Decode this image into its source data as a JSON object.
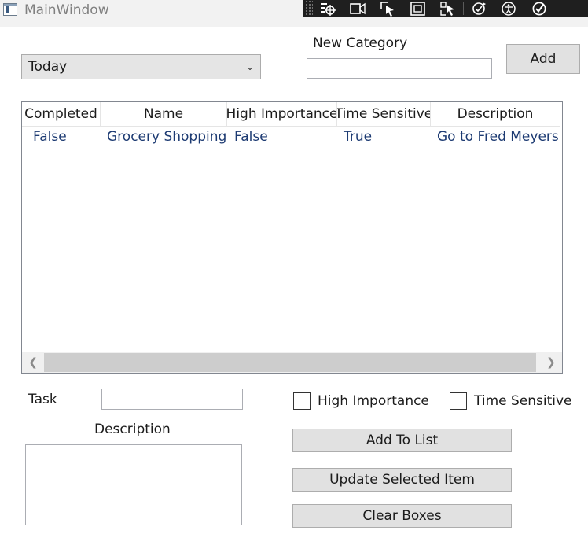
{
  "window": {
    "title": "MainWindow"
  },
  "debug_toolbar": {
    "buttons": [
      "select-element-icon",
      "video-icon",
      "pointer-select-icon",
      "layout-adorner-icon",
      "track-focus-icon",
      "hot-reload-icon",
      "accessibility-icon",
      "check-icon"
    ]
  },
  "category": {
    "selected": "Today"
  },
  "new_category": {
    "label": "New Category",
    "value": "",
    "add_label": "Add"
  },
  "list": {
    "columns": [
      "Completed",
      "Name",
      "High Importance",
      "Time Sensitive",
      "Description"
    ],
    "rows": [
      [
        "False",
        "Grocery Shopping",
        "False",
        "True",
        "Go to Fred Meyers"
      ]
    ]
  },
  "form": {
    "task_label": "Task",
    "task_value": "",
    "description_label": "Description",
    "description_value": "",
    "high_importance_label": "High Importance",
    "high_importance_checked": false,
    "time_sensitive_label": "Time Sensitive",
    "time_sensitive_checked": false,
    "add_to_list": "Add To List",
    "update_selected": "Update Selected Item",
    "clear_boxes": "Clear Boxes"
  },
  "colors": {
    "row_text": "#1c3a72",
    "button_bg": "#e1e1e1",
    "toolbar_bg": "#1f1f1f"
  }
}
